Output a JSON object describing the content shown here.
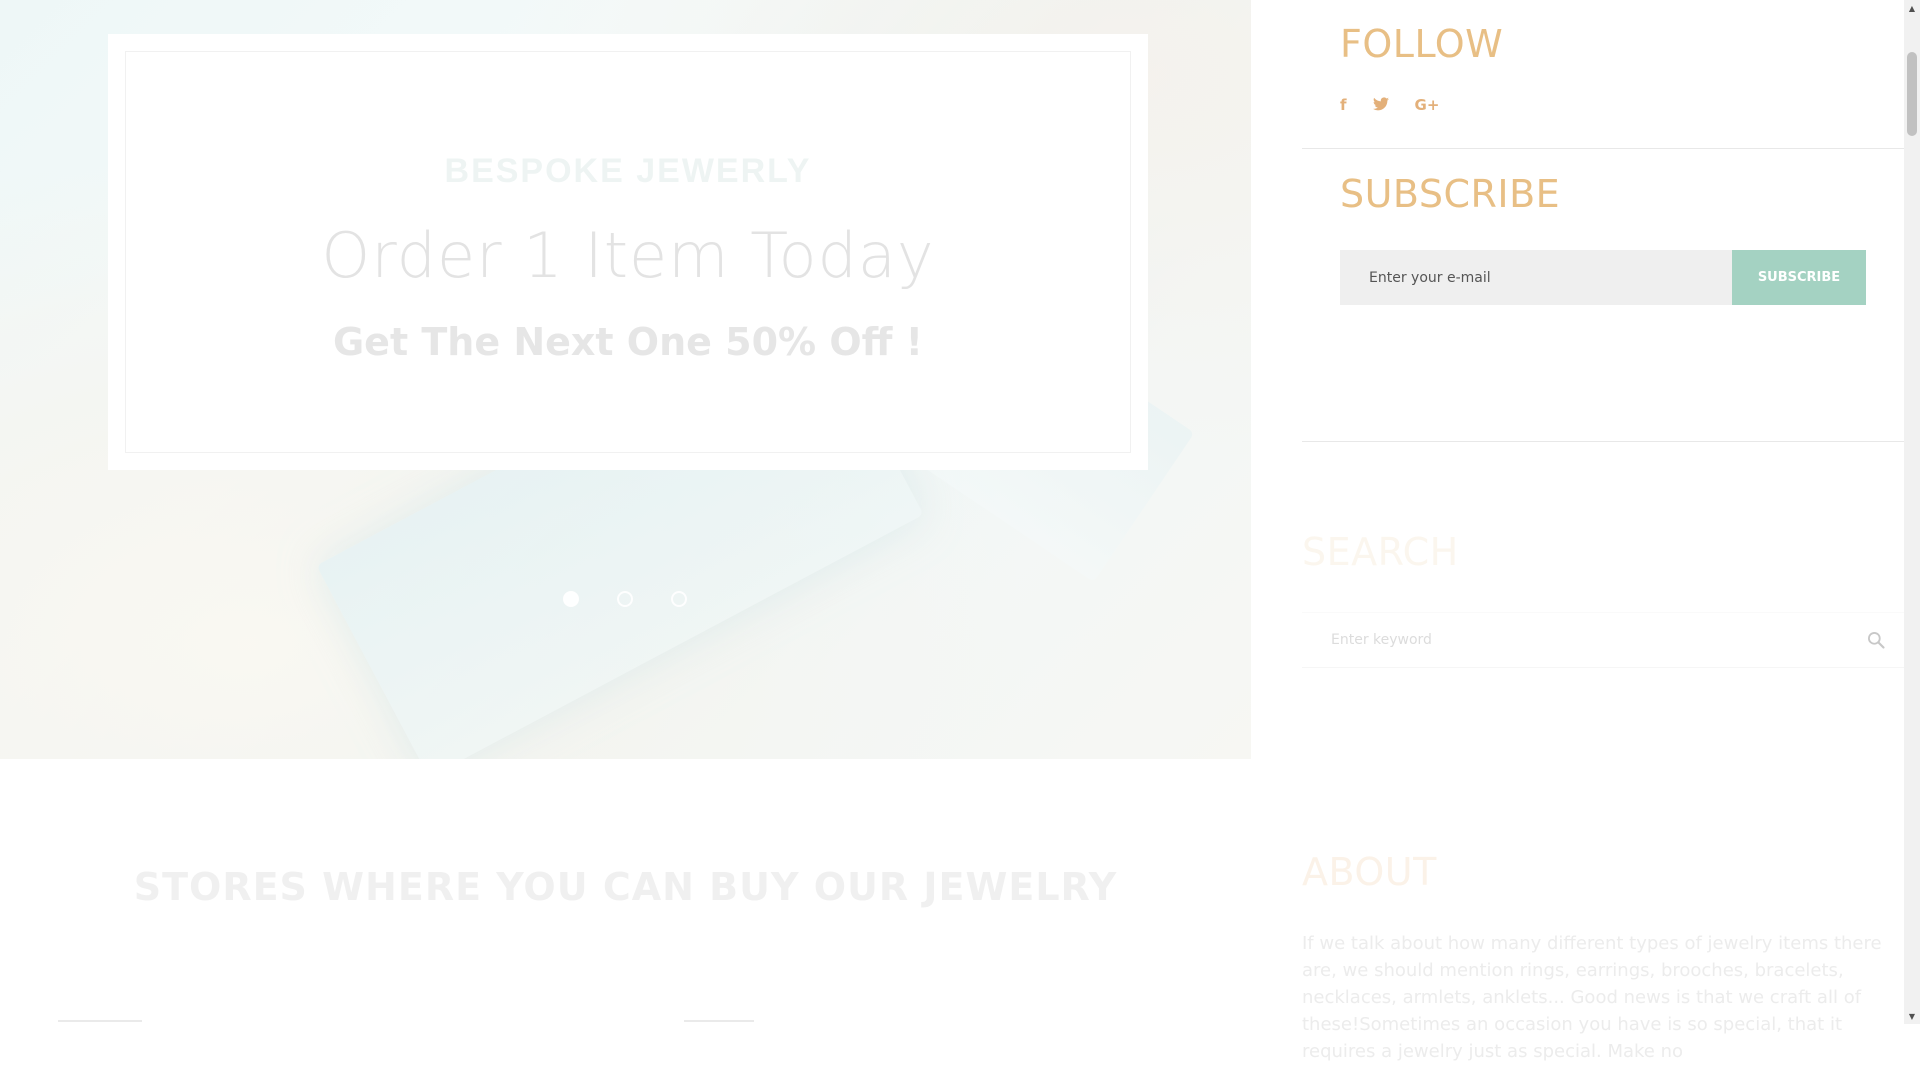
{
  "hero": {
    "kicker": "BESPOKE JEWERLY",
    "title": "Order 1 Item Today",
    "subtitle": "Get The Next One 50% Off !",
    "slides": 3,
    "active_slide": 1
  },
  "stores": {
    "heading": "STORES WHERE YOU CAN BUY OUR JEWELRY"
  },
  "sidebar": {
    "follow": {
      "title": "FOLLOW",
      "icons": [
        "facebook-icon",
        "twitter-icon",
        "google-plus-icon"
      ],
      "icon_glyphs": [
        "f",
        "t",
        "G+"
      ]
    },
    "subscribe": {
      "title": "SUBSCRIBE",
      "placeholder": "Enter your e-mail",
      "button_label": "SUBSCRIBE"
    },
    "search": {
      "title": "SEARCH",
      "placeholder": "Enter keyword",
      "icon": "search-icon"
    },
    "about": {
      "title": "ABOUT",
      "text": "If we talk about how many different types of jewelry items there are, we should mention rings, earrings, brooches, bracelets, necklaces, armlets, anklets... Good news is that we craft all of these!Sometimes an occasion you have is so special, that it requires a jewelry just as special. Make no"
    }
  },
  "colors": {
    "accent_gold": "#e8bf85",
    "subscribe_button": "#a4d2c2",
    "input_bg": "#efefef"
  }
}
